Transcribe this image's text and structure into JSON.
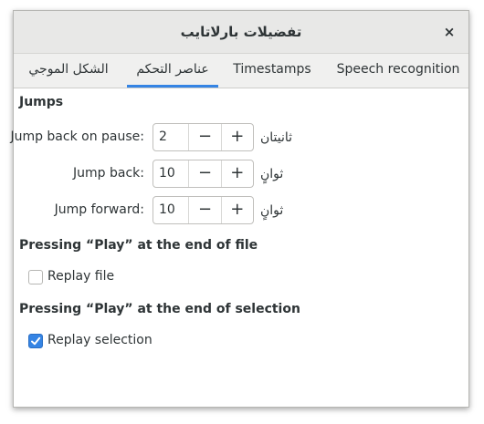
{
  "window": {
    "title": "تفضيلات بارلاتايب",
    "close_label": "×"
  },
  "tabs": [
    {
      "label": "Speech recognition"
    },
    {
      "label": "Timestamps"
    },
    {
      "label": "عناصر التحكم",
      "active": true
    },
    {
      "label": "الشكل الموجي"
    }
  ],
  "jumps": {
    "heading": "Jumps",
    "rows": [
      {
        "label": "Jump back on pause:",
        "value": "2",
        "unit": "ثانيتان"
      },
      {
        "label": "Jump back:",
        "value": "10",
        "unit": "ثوانٍ"
      },
      {
        "label": "Jump forward:",
        "value": "10",
        "unit": "ثوانٍ"
      }
    ],
    "minus": "−",
    "plus": "+"
  },
  "end_of_file": {
    "heading": "Pressing “Play” at the end of file",
    "checkbox_label": "Replay file",
    "checked": false
  },
  "end_of_selection": {
    "heading": "Pressing “Play” at the end of selection",
    "checkbox_label": "Replay selection",
    "checked": true
  },
  "colors": {
    "accent": "#3584e4",
    "titlebar": "#e8e8e7",
    "text": "#2e3436"
  }
}
